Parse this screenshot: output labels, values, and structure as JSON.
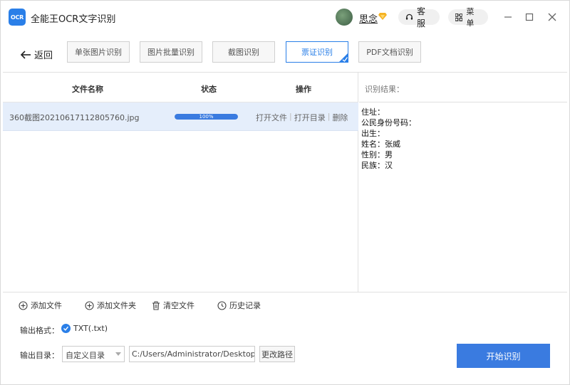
{
  "app": {
    "title": "全能王OCR文字识别",
    "logo_text": "OCR"
  },
  "user": {
    "name": "思念"
  },
  "header": {
    "service_label": "客服",
    "menu_label": "菜单"
  },
  "toolbar": {
    "back_label": "返回",
    "modes": [
      "单张图片识别",
      "图片批量识别",
      "截图识别",
      "票证识别",
      "PDF文档识别"
    ],
    "active_mode": "票证识别"
  },
  "table": {
    "headers": {
      "name": "文件名称",
      "status": "状态",
      "ops": "操作"
    },
    "rows": [
      {
        "filename": "360截图20210617112805760.jpg",
        "progress": 100,
        "progress_label": "100%",
        "ops": [
          "打开文件",
          "打开目录",
          "删除"
        ]
      }
    ]
  },
  "result": {
    "header": "识别结果：",
    "lines": [
      "住址：",
      "公民身份号码：",
      "出生：",
      "姓名：张威",
      "性别：男",
      "民族：汉"
    ]
  },
  "bottom": {
    "actions": [
      "添加文件",
      "添加文件夹",
      "清空文件",
      "历史记录"
    ],
    "format_label": "输出格式：",
    "format_value": "TXT(.txt)",
    "dir_label": "输出目录：",
    "dir_select": "自定义目录",
    "dir_path": "C:/Users/Administrator/Desktop/OC",
    "change_path_label": "更改路径",
    "start_label": "开始识别"
  },
  "colors": {
    "accent": "#3a7be0",
    "row_highlight": "#e5eefb",
    "vip": "#f5b324"
  }
}
